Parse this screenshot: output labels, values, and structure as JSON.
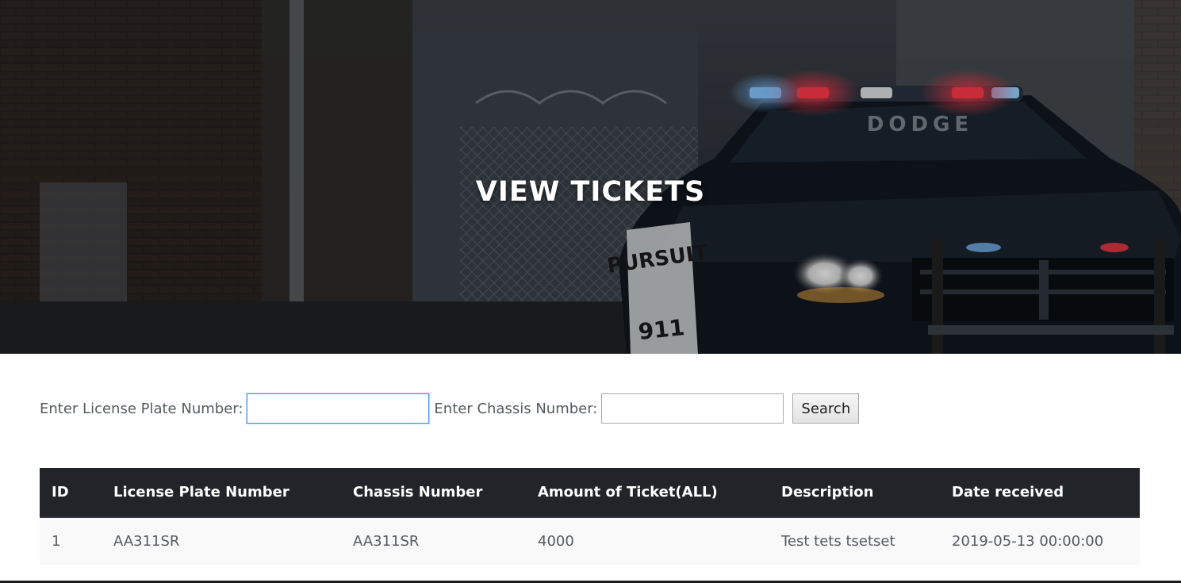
{
  "hero": {
    "title": "VIEW TICKETS",
    "car_brand_text": "DODGE",
    "car_side_text": "PURSUIT",
    "car_number_text": "911"
  },
  "search": {
    "license_label": "Enter License Plate Number:",
    "license_value": "",
    "chassis_label": "Enter Chassis Number:",
    "chassis_value": "",
    "button_label": "Search"
  },
  "table": {
    "columns": [
      "ID",
      "License Plate Number",
      "Chassis Number",
      "Amount of Ticket(ALL)",
      "Description",
      "Date received"
    ],
    "rows": [
      [
        "1",
        "AA311SR",
        "AA311SR",
        "4000",
        "Test tets tsetset",
        "2019-05-13 00:00:00"
      ]
    ]
  },
  "colors": {
    "table_header_bg": "#212529",
    "input_focus_border": "#4d90fe",
    "siren_red": "#ff2a3a",
    "siren_blue": "#5aa8ff"
  }
}
